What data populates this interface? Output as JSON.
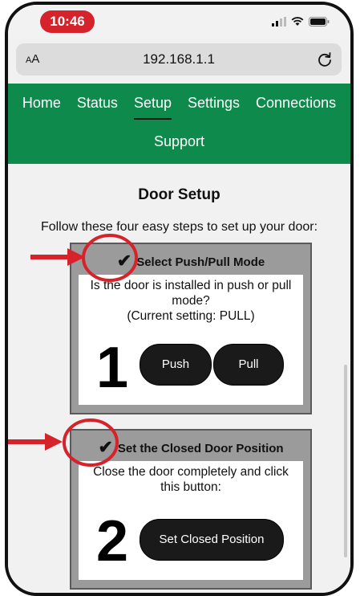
{
  "status_bar": {
    "time": "10:46",
    "icons": [
      "signal-icon",
      "wifi-icon",
      "battery-icon"
    ]
  },
  "address_bar": {
    "text_size_button": "AA",
    "url": "192.168.1.1",
    "reload_icon": "reload-icon"
  },
  "nav": {
    "items": [
      {
        "label": "Home",
        "active": false
      },
      {
        "label": "Status",
        "active": false
      },
      {
        "label": "Setup",
        "active": true
      },
      {
        "label": "Settings",
        "active": false
      },
      {
        "label": "Connections",
        "active": false
      },
      {
        "label": "Support",
        "active": false
      }
    ]
  },
  "page": {
    "title": "Door Setup",
    "intro": "Follow these four easy steps to set up your door:"
  },
  "steps": [
    {
      "number": "1",
      "check": "✔",
      "title": "Select Push/Pull Mode",
      "question": "Is the door is installed in push or pull mode?",
      "current_setting": "(Current setting: PULL)",
      "buttons": [
        "Push",
        "Pull"
      ]
    },
    {
      "number": "2",
      "check": "✔",
      "title": "Set the Closed Door Position",
      "question": "Close the door completely and click this button:",
      "buttons": [
        "Set Closed Position"
      ]
    }
  ],
  "colors": {
    "nav_green": "#0d8a4c",
    "time_pill_red": "#d6232b",
    "annotation_red": "#d6232b",
    "step_box_gray": "#9b9b9b",
    "button_black": "#1a1a1a"
  }
}
